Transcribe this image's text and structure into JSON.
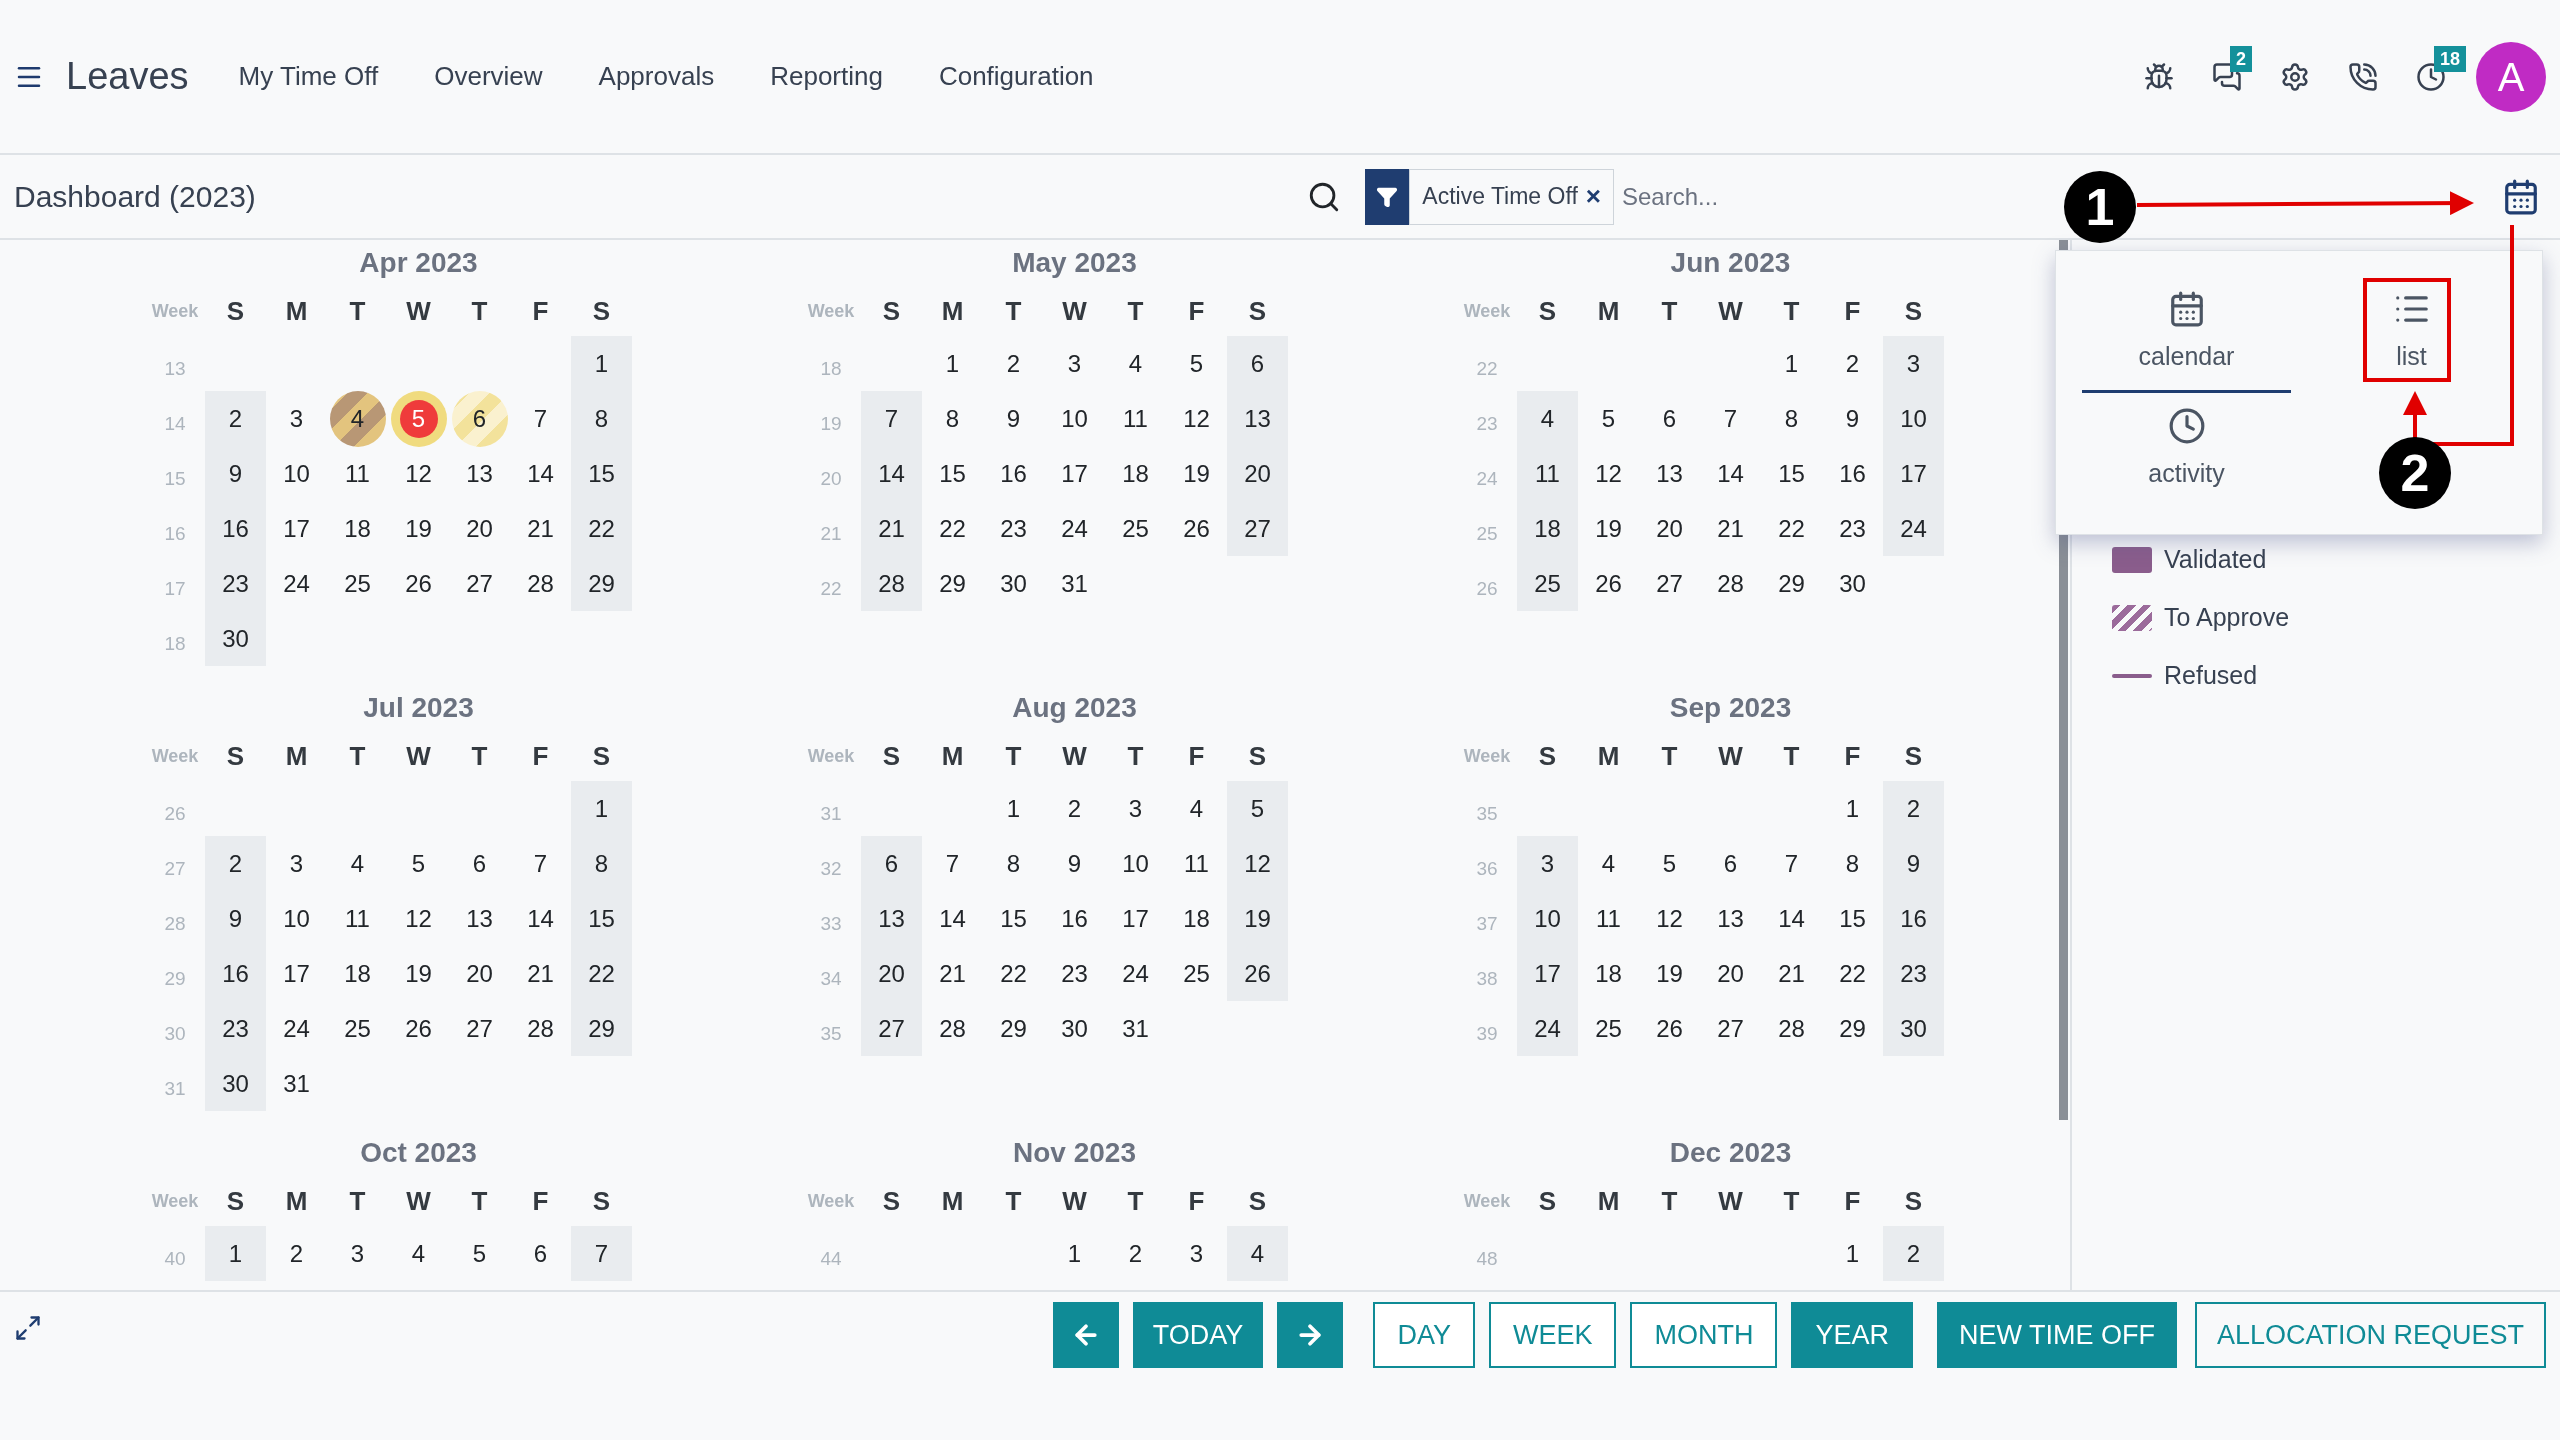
{
  "navbar": {
    "app_name": "Leaves",
    "menu": [
      {
        "label": "My Time Off"
      },
      {
        "label": "Overview"
      },
      {
        "label": "Approvals"
      },
      {
        "label": "Reporting"
      },
      {
        "label": "Configuration"
      }
    ],
    "systray": [
      {
        "kind": "bug"
      },
      {
        "kind": "messages",
        "badge": "2"
      },
      {
        "kind": "settings"
      },
      {
        "kind": "chat-phone"
      },
      {
        "kind": "activity",
        "badge": "18"
      }
    ],
    "avatar": "A"
  },
  "control_panel": {
    "title": "Dashboard (2023)",
    "facet": "Active Time Off",
    "facet_remove": "×",
    "search_placeholder": "Search..."
  },
  "months": [
    {
      "title": "Apr 2023",
      "week_label": "Week",
      "weekdays": [
        "S",
        "M",
        "T",
        "W",
        "T",
        "F",
        "S"
      ],
      "weeks": [
        {
          "number": "13",
          "leading_gap": true,
          "days": [
            "1"
          ]
        },
        {
          "number": "14",
          "days": [
            "2",
            "3",
            {
              "text": "4",
              "kind": "leave"
            },
            {
              "text": "5",
              "kind": "today"
            },
            {
              "text": "6",
              "kind": "pending"
            },
            "7",
            "8"
          ]
        },
        {
          "number": "15",
          "days": [
            "9",
            "10",
            "11",
            "12",
            "13",
            "14",
            "15"
          ]
        },
        {
          "number": "16",
          "days": [
            "16",
            "17",
            "18",
            "19",
            "20",
            "21",
            "22"
          ]
        },
        {
          "number": "17",
          "days": [
            "23",
            "24",
            "25",
            "26",
            "27",
            "28",
            "29"
          ]
        },
        {
          "number": "18",
          "days": [
            "30"
          ]
        }
      ]
    },
    {
      "title": "May 2023",
      "week_label": "Week",
      "weekdays": [
        "S",
        "M",
        "T",
        "W",
        "T",
        "F",
        "S"
      ],
      "weeks": [
        {
          "number": "18",
          "leading_gap": true,
          "days": [
            "1",
            "2",
            "3",
            "4",
            "5",
            "6"
          ]
        },
        {
          "number": "19",
          "days": [
            "7",
            "8",
            "9",
            "10",
            "11",
            "12",
            "13"
          ]
        },
        {
          "number": "20",
          "days": [
            "14",
            "15",
            "16",
            "17",
            "18",
            "19",
            "20"
          ]
        },
        {
          "number": "21",
          "days": [
            "21",
            "22",
            "23",
            "24",
            "25",
            "26",
            "27"
          ]
        },
        {
          "number": "22",
          "days": [
            "28",
            "29",
            "30",
            "31"
          ]
        }
      ]
    },
    {
      "title": "Jun 2023",
      "week_label": "Week",
      "weekdays": [
        "S",
        "M",
        "T",
        "W",
        "T",
        "F",
        "S"
      ],
      "weeks": [
        {
          "number": "22",
          "leading_gap": true,
          "days": [
            "1",
            "2",
            "3"
          ]
        },
        {
          "number": "23",
          "days": [
            "4",
            "5",
            "6",
            "7",
            "8",
            "9",
            "10"
          ]
        },
        {
          "number": "24",
          "days": [
            "11",
            "12",
            "13",
            "14",
            "15",
            "16",
            "17"
          ]
        },
        {
          "number": "25",
          "days": [
            "18",
            "19",
            "20",
            "21",
            "22",
            "23",
            "24"
          ]
        },
        {
          "number": "26",
          "days": [
            "25",
            "26",
            "27",
            "28",
            "29",
            "30"
          ]
        }
      ]
    },
    {
      "title": "Jul 2023",
      "week_label": "Week",
      "weekdays": [
        "S",
        "M",
        "T",
        "W",
        "T",
        "F",
        "S"
      ],
      "weeks": [
        {
          "number": "26",
          "leading_gap": true,
          "days": [
            "1"
          ]
        },
        {
          "number": "27",
          "days": [
            "2",
            "3",
            "4",
            "5",
            "6",
            "7",
            "8"
          ]
        },
        {
          "number": "28",
          "days": [
            "9",
            "10",
            "11",
            "12",
            "13",
            "14",
            "15"
          ]
        },
        {
          "number": "29",
          "days": [
            "16",
            "17",
            "18",
            "19",
            "20",
            "21",
            "22"
          ]
        },
        {
          "number": "30",
          "days": [
            "23",
            "24",
            "25",
            "26",
            "27",
            "28",
            "29"
          ]
        },
        {
          "number": "31",
          "days": [
            "30",
            "31"
          ]
        }
      ]
    },
    {
      "title": "Aug 2023",
      "week_label": "Week",
      "weekdays": [
        "S",
        "M",
        "T",
        "W",
        "T",
        "F",
        "S"
      ],
      "weeks": [
        {
          "number": "31",
          "leading_gap": true,
          "days": [
            "1",
            "2",
            "3",
            "4",
            "5"
          ]
        },
        {
          "number": "32",
          "days": [
            "6",
            "7",
            "8",
            "9",
            "10",
            "11",
            "12"
          ]
        },
        {
          "number": "33",
          "days": [
            "13",
            "14",
            "15",
            "16",
            "17",
            "18",
            "19"
          ]
        },
        {
          "number": "34",
          "days": [
            "20",
            "21",
            "22",
            "23",
            "24",
            "25",
            "26"
          ]
        },
        {
          "number": "35",
          "days": [
            "27",
            "28",
            "29",
            "30",
            "31"
          ]
        }
      ]
    },
    {
      "title": "Sep 2023",
      "week_label": "Week",
      "weekdays": [
        "S",
        "M",
        "T",
        "W",
        "T",
        "F",
        "S"
      ],
      "weeks": [
        {
          "number": "35",
          "leading_gap": true,
          "days": [
            "1",
            "2"
          ]
        },
        {
          "number": "36",
          "days": [
            "3",
            "4",
            "5",
            "6",
            "7",
            "8",
            "9"
          ]
        },
        {
          "number": "37",
          "days": [
            "10",
            "11",
            "12",
            "13",
            "14",
            "15",
            "16"
          ]
        },
        {
          "number": "38",
          "days": [
            "17",
            "18",
            "19",
            "20",
            "21",
            "22",
            "23"
          ]
        },
        {
          "number": "39",
          "days": [
            "24",
            "25",
            "26",
            "27",
            "28",
            "29",
            "30"
          ]
        }
      ]
    },
    {
      "title": "Oct 2023",
      "week_label": "Week",
      "weekdays": [
        "S",
        "M",
        "T",
        "W",
        "T",
        "F",
        "S"
      ],
      "weeks": [
        {
          "number": "40",
          "days": [
            "1",
            "2",
            "3",
            "4",
            "5",
            "6",
            "7"
          ]
        }
      ]
    },
    {
      "title": "Nov 2023",
      "week_label": "Week",
      "weekdays": [
        "S",
        "M",
        "T",
        "W",
        "T",
        "F",
        "S"
      ],
      "weeks": [
        {
          "number": "44",
          "leading_gap": true,
          "days": [
            "1",
            "2",
            "3",
            "4"
          ]
        }
      ]
    },
    {
      "title": "Dec 2023",
      "week_label": "Week",
      "weekdays": [
        "S",
        "M",
        "T",
        "W",
        "T",
        "F",
        "S"
      ],
      "weeks": [
        {
          "number": "48",
          "leading_gap": true,
          "days": [
            "1",
            "2"
          ]
        }
      ]
    }
  ],
  "legend": [
    {
      "label": "Validated",
      "kind": "filled"
    },
    {
      "label": "To Approve",
      "kind": "striped"
    },
    {
      "label": "Refused",
      "kind": "line"
    }
  ],
  "view_switcher": [
    {
      "label": "calendar",
      "kind": "calendar",
      "selected": true
    },
    {
      "label": "list",
      "kind": "list",
      "selected": false
    },
    {
      "label": "activity",
      "kind": "activity",
      "selected": false
    }
  ],
  "annotations": [
    "1",
    "2"
  ],
  "bottom_bar": {
    "nav": [
      {
        "kind": "prev"
      },
      {
        "kind": "today",
        "label": "TODAY"
      },
      {
        "kind": "next"
      }
    ],
    "scales": [
      {
        "label": "DAY",
        "selected": false
      },
      {
        "label": "WEEK",
        "selected": false
      },
      {
        "label": "MONTH",
        "selected": false
      },
      {
        "label": "YEAR",
        "selected": true
      }
    ],
    "new_button": "NEW TIME OFF",
    "allocation_button": "ALLOCATION REQUEST"
  }
}
